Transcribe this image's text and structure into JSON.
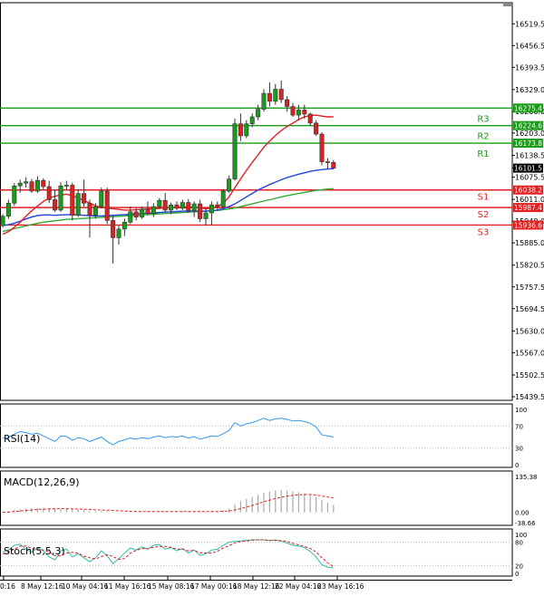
{
  "chart_data": {
    "type": "candlestick",
    "colors": {
      "up": "#1a9b1a",
      "down": "#e02020",
      "ma_red": "#e02020",
      "ma_blue": "#2244dd",
      "ma_green": "#33aa33",
      "resistance": "#1a9b1a",
      "support": "#e02020",
      "rsi": "#3399ee",
      "macd_hist": "#aaaaaa",
      "macd_signal": "#e02020",
      "stoch_main": "#33bbaa",
      "stoch_signal": "#e02020",
      "grid": "#bbbbbb",
      "current_price_bg": "#000000"
    },
    "price_axis": {
      "ylim": [
        15439.5,
        16570
      ],
      "ticks": [
        "16519.5",
        "16456.5",
        "16393.5",
        "16329.0",
        "16266.0",
        "16203.0",
        "16138.5",
        "16075.5",
        "16011.0",
        "15948.0",
        "15885.0",
        "15820.5",
        "15757.5",
        "15694.5",
        "15630.0",
        "15567.0",
        "15502.5",
        "15439.5"
      ]
    },
    "current_price": {
      "value": 16101.5,
      "label": "16101.5"
    },
    "levels": [
      {
        "name": "R3",
        "value": 16275.4,
        "label": "16275.4",
        "kind": "resistance"
      },
      {
        "name": "R2",
        "value": 16224.6,
        "label": "16224.6",
        "kind": "resistance"
      },
      {
        "name": "R1",
        "value": 16173.8,
        "label": "16173.8",
        "kind": "resistance"
      },
      {
        "name": "S1",
        "value": 16038.2,
        "label": "16038.2",
        "kind": "support"
      },
      {
        "name": "S2",
        "value": 15987.4,
        "label": "15987.4",
        "kind": "support"
      },
      {
        "name": "S3",
        "value": 15936.6,
        "label": "15936.6",
        "kind": "support"
      }
    ],
    "x_labels": [
      "0:16",
      "8 May 12:16",
      "10 May 04:16",
      "11 May 16:16",
      "15 May 08:16",
      "17 May 00:16",
      "18 May 12:16",
      "22 May 04:16",
      "23 May 16:16"
    ],
    "candles": [
      {
        "o": 15935,
        "h": 15968,
        "l": 15930,
        "c": 15962
      },
      {
        "o": 15962,
        "h": 16010,
        "l": 15955,
        "c": 16000
      },
      {
        "o": 16000,
        "h": 16058,
        "l": 15992,
        "c": 16050
      },
      {
        "o": 16050,
        "h": 16068,
        "l": 16030,
        "c": 16058
      },
      {
        "o": 16058,
        "h": 16075,
        "l": 16045,
        "c": 16062
      },
      {
        "o": 16062,
        "h": 16070,
        "l": 16030,
        "c": 16035
      },
      {
        "o": 16035,
        "h": 16078,
        "l": 16030,
        "c": 16066
      },
      {
        "o": 16066,
        "h": 16072,
        "l": 16040,
        "c": 16048
      },
      {
        "o": 16048,
        "h": 16065,
        "l": 16000,
        "c": 16010
      },
      {
        "o": 16010,
        "h": 16038,
        "l": 15975,
        "c": 15980
      },
      {
        "o": 15980,
        "h": 16060,
        "l": 15975,
        "c": 16050
      },
      {
        "o": 16050,
        "h": 16065,
        "l": 16040,
        "c": 16052
      },
      {
        "o": 16052,
        "h": 16060,
        "l": 15950,
        "c": 15965
      },
      {
        "o": 15965,
        "h": 16040,
        "l": 15960,
        "c": 16028
      },
      {
        "o": 16028,
        "h": 16068,
        "l": 15990,
        "c": 16000
      },
      {
        "o": 16000,
        "h": 16010,
        "l": 15900,
        "c": 15965
      },
      {
        "o": 15965,
        "h": 16000,
        "l": 15955,
        "c": 15990
      },
      {
        "o": 15990,
        "h": 16045,
        "l": 15985,
        "c": 16035
      },
      {
        "o": 16035,
        "h": 16045,
        "l": 15940,
        "c": 15950
      },
      {
        "o": 15950,
        "h": 15962,
        "l": 15825,
        "c": 15900
      },
      {
        "o": 15900,
        "h": 15935,
        "l": 15880,
        "c": 15925
      },
      {
        "o": 15925,
        "h": 15955,
        "l": 15905,
        "c": 15945
      },
      {
        "o": 15945,
        "h": 15990,
        "l": 15940,
        "c": 15975
      },
      {
        "o": 15975,
        "h": 15985,
        "l": 15950,
        "c": 15960
      },
      {
        "o": 15960,
        "h": 15990,
        "l": 15955,
        "c": 15982
      },
      {
        "o": 15982,
        "h": 16005,
        "l": 15965,
        "c": 15970
      },
      {
        "o": 15970,
        "h": 16000,
        "l": 15960,
        "c": 15990
      },
      {
        "o": 15990,
        "h": 16015,
        "l": 15985,
        "c": 16008
      },
      {
        "o": 16008,
        "h": 16030,
        "l": 15975,
        "c": 15980
      },
      {
        "o": 15980,
        "h": 16002,
        "l": 15968,
        "c": 15995
      },
      {
        "o": 15995,
        "h": 16005,
        "l": 15980,
        "c": 15985
      },
      {
        "o": 15985,
        "h": 16010,
        "l": 15980,
        "c": 16002
      },
      {
        "o": 16002,
        "h": 16012,
        "l": 15972,
        "c": 15978
      },
      {
        "o": 15978,
        "h": 16005,
        "l": 15960,
        "c": 15998
      },
      {
        "o": 15998,
        "h": 16010,
        "l": 15945,
        "c": 15955
      },
      {
        "o": 15955,
        "h": 15985,
        "l": 15935,
        "c": 15972
      },
      {
        "o": 15972,
        "h": 16005,
        "l": 15938,
        "c": 15995
      },
      {
        "o": 15995,
        "h": 16005,
        "l": 15978,
        "c": 15990
      },
      {
        "o": 15990,
        "h": 16040,
        "l": 15985,
        "c": 16035
      },
      {
        "o": 16035,
        "h": 16080,
        "l": 16030,
        "c": 16070
      },
      {
        "o": 16070,
        "h": 16245,
        "l": 16065,
        "c": 16230
      },
      {
        "o": 16230,
        "h": 16260,
        "l": 16180,
        "c": 16195
      },
      {
        "o": 16195,
        "h": 16240,
        "l": 16188,
        "c": 16230
      },
      {
        "o": 16230,
        "h": 16260,
        "l": 16220,
        "c": 16250
      },
      {
        "o": 16250,
        "h": 16285,
        "l": 16240,
        "c": 16272
      },
      {
        "o": 16272,
        "h": 16330,
        "l": 16265,
        "c": 16318
      },
      {
        "o": 16318,
        "h": 16350,
        "l": 16280,
        "c": 16295
      },
      {
        "o": 16295,
        "h": 16345,
        "l": 16285,
        "c": 16330
      },
      {
        "o": 16330,
        "h": 16355,
        "l": 16290,
        "c": 16300
      },
      {
        "o": 16300,
        "h": 16310,
        "l": 16265,
        "c": 16280
      },
      {
        "o": 16280,
        "h": 16290,
        "l": 16250,
        "c": 16255
      },
      {
        "o": 16255,
        "h": 16285,
        "l": 16240,
        "c": 16270
      },
      {
        "o": 16270,
        "h": 16285,
        "l": 16245,
        "c": 16258
      },
      {
        "o": 16258,
        "h": 16262,
        "l": 16225,
        "c": 16232
      },
      {
        "o": 16232,
        "h": 16240,
        "l": 16195,
        "c": 16200
      },
      {
        "o": 16200,
        "h": 16205,
        "l": 16110,
        "c": 16120
      },
      {
        "o": 16120,
        "h": 16130,
        "l": 16098,
        "c": 16118
      },
      {
        "o": 16118,
        "h": 16125,
        "l": 16098,
        "c": 16101.5
      }
    ],
    "ma_red": [
      15910,
      15918,
      15930,
      15945,
      15962,
      15978,
      15992,
      16005,
      16015,
      16020,
      16024,
      16026,
      16022,
      16015,
      16008,
      16000,
      15992,
      15988,
      15986,
      15984,
      15982,
      15980,
      15980,
      15981,
      15982,
      15983,
      15984,
      15985,
      15986,
      15987,
      15988,
      15989,
      15989,
      15988,
      15986,
      15984,
      15985,
      15990,
      16000,
      16018,
      16045,
      16070,
      16095,
      16118,
      16140,
      16162,
      16180,
      16196,
      16210,
      16222,
      16232,
      16242,
      16250,
      16254,
      16255,
      16252,
      16250,
      16250
    ],
    "ma_blue": [
      15935,
      15938,
      15942,
      15948,
      15954,
      15960,
      15964,
      15966,
      15966,
      15965,
      15966,
      15967,
      15967,
      15966,
      15965,
      15964,
      15963,
      15963,
      15964,
      15965,
      15966,
      15967,
      15968,
      15969,
      15970,
      15971,
      15972,
      15973,
      15974,
      15975,
      15976,
      15977,
      15977,
      15977,
      15977,
      15977,
      15978,
      15980,
      15984,
      15990,
      15998,
      16008,
      16018,
      16028,
      16038,
      16046,
      16054,
      16061,
      16068,
      16074,
      16079,
      16084,
      16088,
      16092,
      16095,
      16097,
      16099,
      16100
    ],
    "ma_green": [
      15918,
      15922,
      15926,
      15930,
      15934,
      15938,
      15942,
      15945,
      15947,
      15949,
      15951,
      15953,
      15954,
      15955,
      15956,
      15957,
      15958,
      15959,
      15960,
      15961,
      15962,
      15963,
      15964,
      15965,
      15966,
      15967,
      15968,
      15969,
      15970,
      15971,
      15972,
      15973,
      15974,
      15975,
      15976,
      15977,
      15978,
      15979,
      15981,
      15983,
      15986,
      15990,
      15994,
      15998,
      16002,
      16006,
      16010,
      16014,
      16018,
      16022,
      16025,
      16028,
      16031,
      16034,
      16037,
      16039,
      16041,
      16042
    ],
    "rsi": {
      "label": "RSI(14)",
      "ticks": [
        "100",
        "70",
        "30",
        "0"
      ],
      "ylim": [
        0,
        100
      ],
      "values": [
        48,
        50,
        55,
        60,
        58,
        55,
        57,
        52,
        47,
        42,
        52,
        51,
        44,
        49,
        47,
        42,
        46,
        50,
        42,
        36,
        42,
        45,
        48,
        46,
        49,
        47,
        50,
        52,
        49,
        51,
        50,
        52,
        48,
        51,
        46,
        49,
        52,
        51,
        56,
        62,
        76,
        70,
        74,
        76,
        80,
        84,
        80,
        83,
        84,
        82,
        79,
        80,
        78,
        75,
        68,
        54,
        52,
        50
      ]
    },
    "macd": {
      "label": "MACD(12,26,9)",
      "ticks": [
        "135.38",
        "0.00",
        "-38.66"
      ],
      "ylim": [
        -38.66,
        135.38
      ],
      "hist": [
        2,
        5,
        9,
        12,
        14,
        15,
        17,
        17,
        16,
        14,
        14,
        13,
        11,
        11,
        9,
        6,
        5,
        6,
        4,
        1,
        0,
        0,
        1,
        1,
        2,
        2,
        3,
        4,
        4,
        4,
        4,
        5,
        4,
        5,
        3,
        3,
        4,
        5,
        8,
        14,
        30,
        40,
        50,
        58,
        66,
        74,
        78,
        82,
        84,
        82,
        79,
        76,
        72,
        66,
        58,
        46,
        36,
        28
      ],
      "signal": [
        0,
        1,
        3,
        5,
        7,
        9,
        11,
        12,
        13,
        14,
        14,
        14,
        13,
        13,
        12,
        11,
        10,
        9,
        8,
        7,
        6,
        5,
        4,
        3,
        3,
        3,
        3,
        3,
        3,
        3,
        3,
        3,
        3,
        3,
        3,
        3,
        3,
        3,
        4,
        5,
        9,
        14,
        20,
        26,
        33,
        40,
        46,
        52,
        57,
        61,
        64,
        66,
        67,
        67,
        65,
        62,
        58,
        54
      ]
    },
    "stoch": {
      "label": "Stoch(5,5,3)",
      "ticks": [
        "100",
        "80",
        "20",
        "0"
      ],
      "ylim": [
        0,
        100
      ],
      "main": [
        55,
        60,
        72,
        75,
        62,
        55,
        66,
        58,
        42,
        35,
        58,
        62,
        42,
        50,
        40,
        30,
        40,
        58,
        45,
        25,
        38,
        52,
        65,
        60,
        68,
        62,
        72,
        74,
        62,
        66,
        58,
        64,
        52,
        60,
        46,
        50,
        60,
        62,
        72,
        80,
        82,
        83,
        85,
        86,
        86,
        86,
        84,
        86,
        82,
        78,
        72,
        70,
        66,
        56,
        42,
        22,
        16,
        14
      ],
      "signal": [
        50,
        55,
        62,
        70,
        70,
        64,
        61,
        60,
        55,
        45,
        45,
        52,
        54,
        52,
        44,
        40,
        37,
        43,
        48,
        43,
        36,
        38,
        52,
        59,
        64,
        63,
        67,
        69,
        69,
        67,
        62,
        62,
        58,
        59,
        53,
        52,
        52,
        57,
        65,
        71,
        78,
        82,
        83,
        85,
        86,
        86,
        85,
        85,
        84,
        82,
        77,
        73,
        69,
        64,
        55,
        40,
        27,
        17
      ]
    }
  }
}
